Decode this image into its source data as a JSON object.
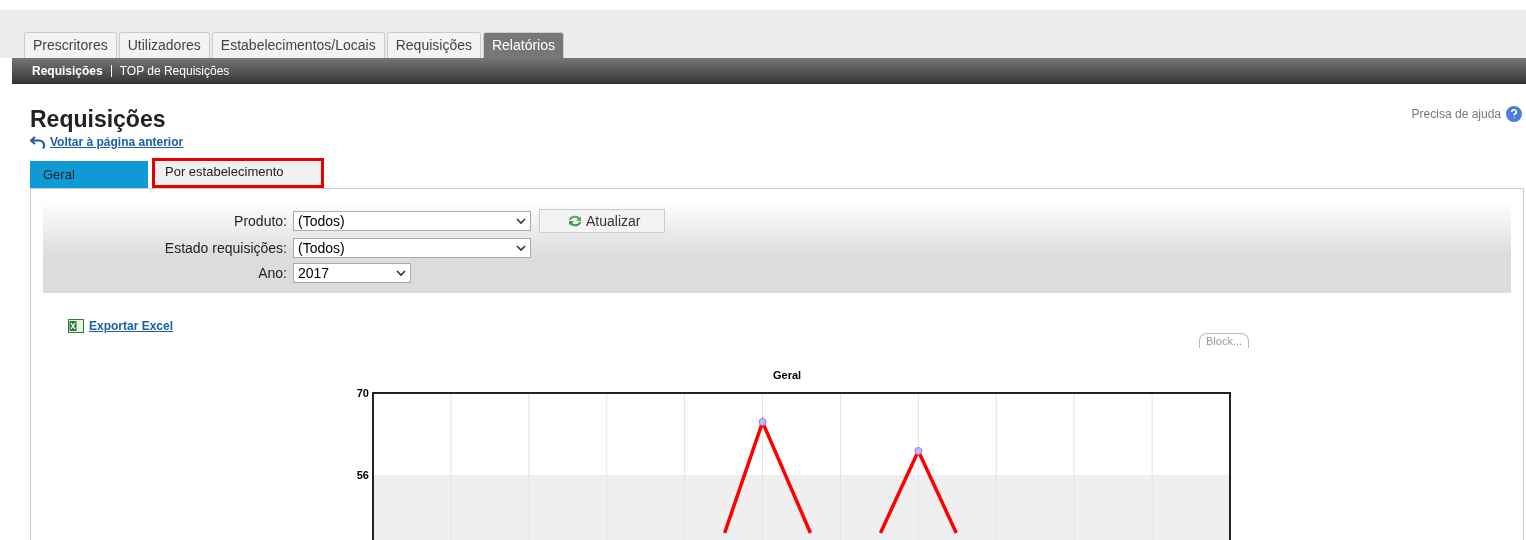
{
  "nav_tabs": [
    {
      "label": "Prescritores",
      "selected": false
    },
    {
      "label": "Utilizadores",
      "selected": false
    },
    {
      "label": "Estabelecimentos/Locais",
      "selected": false
    },
    {
      "label": "Requisições",
      "selected": false
    },
    {
      "label": "Relatórios",
      "selected": true
    }
  ],
  "sub_nav": [
    {
      "label": "Requisições",
      "selected": true
    },
    {
      "label": "TOP de Requisições",
      "selected": false
    }
  ],
  "page_title": "Requisições",
  "help_link": "Precisa de ajuda",
  "back_link": "Voltar à página anterior",
  "report_tabs": [
    {
      "label": "Geral",
      "selected": true,
      "highlighted": false
    },
    {
      "label": "Por estabelecimento",
      "selected": false,
      "highlighted": true
    }
  ],
  "filters": [
    {
      "label": "Produto:",
      "value": "(Todos)"
    },
    {
      "label": "Estado requisições:",
      "value": "(Todos)"
    },
    {
      "label": "Ano:",
      "value": "2017"
    }
  ],
  "refresh_button": "Atualizar",
  "export_link": "Exportar Excel",
  "chart_button": "Block...",
  "chart": {
    "title": "Geral",
    "y_tick_labels": [
      "70",
      "56"
    ]
  }
}
